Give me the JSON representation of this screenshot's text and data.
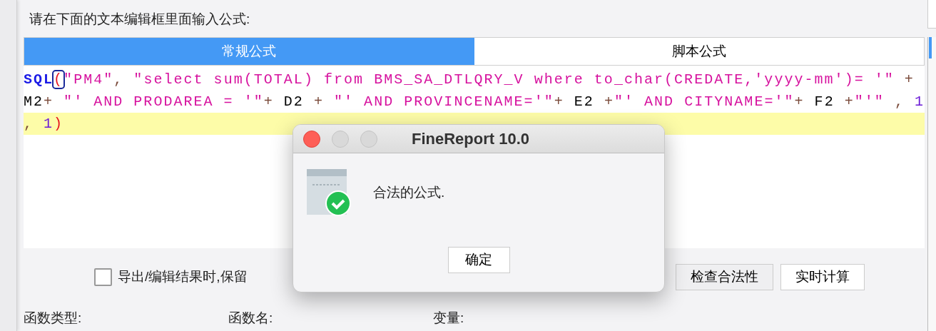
{
  "prompt": "请在下面的文本编辑框里面输入公式:",
  "tabs": [
    {
      "label": "常规公式",
      "selected": true
    },
    {
      "label": "脚本公式",
      "selected": false
    }
  ],
  "editor": {
    "lines": [
      {
        "current": false,
        "tokens": [
          {
            "kind": "keyword",
            "text": "SQL"
          },
          {
            "kind": "bracket",
            "text": "(",
            "matched": true
          },
          {
            "kind": "string",
            "text": "\"PM4\""
          },
          {
            "kind": "operator",
            "text": ", "
          },
          {
            "kind": "string",
            "text": "\"select sum(TOTAL) from BMS_SA_DTLQRY_V where to_char(CREDATE,'yyyy-mm')= '\""
          },
          {
            "kind": "operator",
            "text": " +"
          }
        ]
      },
      {
        "current": false,
        "tokens": [
          {
            "kind": "ref",
            "text": "M2"
          },
          {
            "kind": "operator",
            "text": "+ "
          },
          {
            "kind": "string",
            "text": "\"' AND PRODAREA = '\""
          },
          {
            "kind": "operator",
            "text": "+ "
          },
          {
            "kind": "ref",
            "text": "D2"
          },
          {
            "kind": "operator",
            "text": " + "
          },
          {
            "kind": "string",
            "text": "\"' AND PROVINCENAME='\""
          },
          {
            "kind": "operator",
            "text": "+ "
          },
          {
            "kind": "ref",
            "text": "E2"
          },
          {
            "kind": "operator",
            "text": " +"
          },
          {
            "kind": "string",
            "text": "\"' AND CITYNAME='\""
          },
          {
            "kind": "operator",
            "text": "+ "
          },
          {
            "kind": "ref",
            "text": "F2"
          },
          {
            "kind": "operator",
            "text": " +"
          },
          {
            "kind": "string",
            "text": "\"'\""
          },
          {
            "kind": "operator",
            "text": " , "
          },
          {
            "kind": "number",
            "text": "1"
          }
        ]
      },
      {
        "current": true,
        "tokens": [
          {
            "kind": "operator",
            "text": ", "
          },
          {
            "kind": "number",
            "text": "1"
          },
          {
            "kind": "bracket",
            "text": ")",
            "matched": false
          }
        ]
      }
    ]
  },
  "option": {
    "label": "导出/编辑结果时,保留",
    "checked": false
  },
  "buttons": [
    "检查合法性",
    "实时计算"
  ],
  "sections": [
    "函数类型:",
    "函数名:",
    "变量:"
  ],
  "dialog": {
    "title": "FineReport 10.0",
    "message": "合法的公式.",
    "button": "确定"
  }
}
